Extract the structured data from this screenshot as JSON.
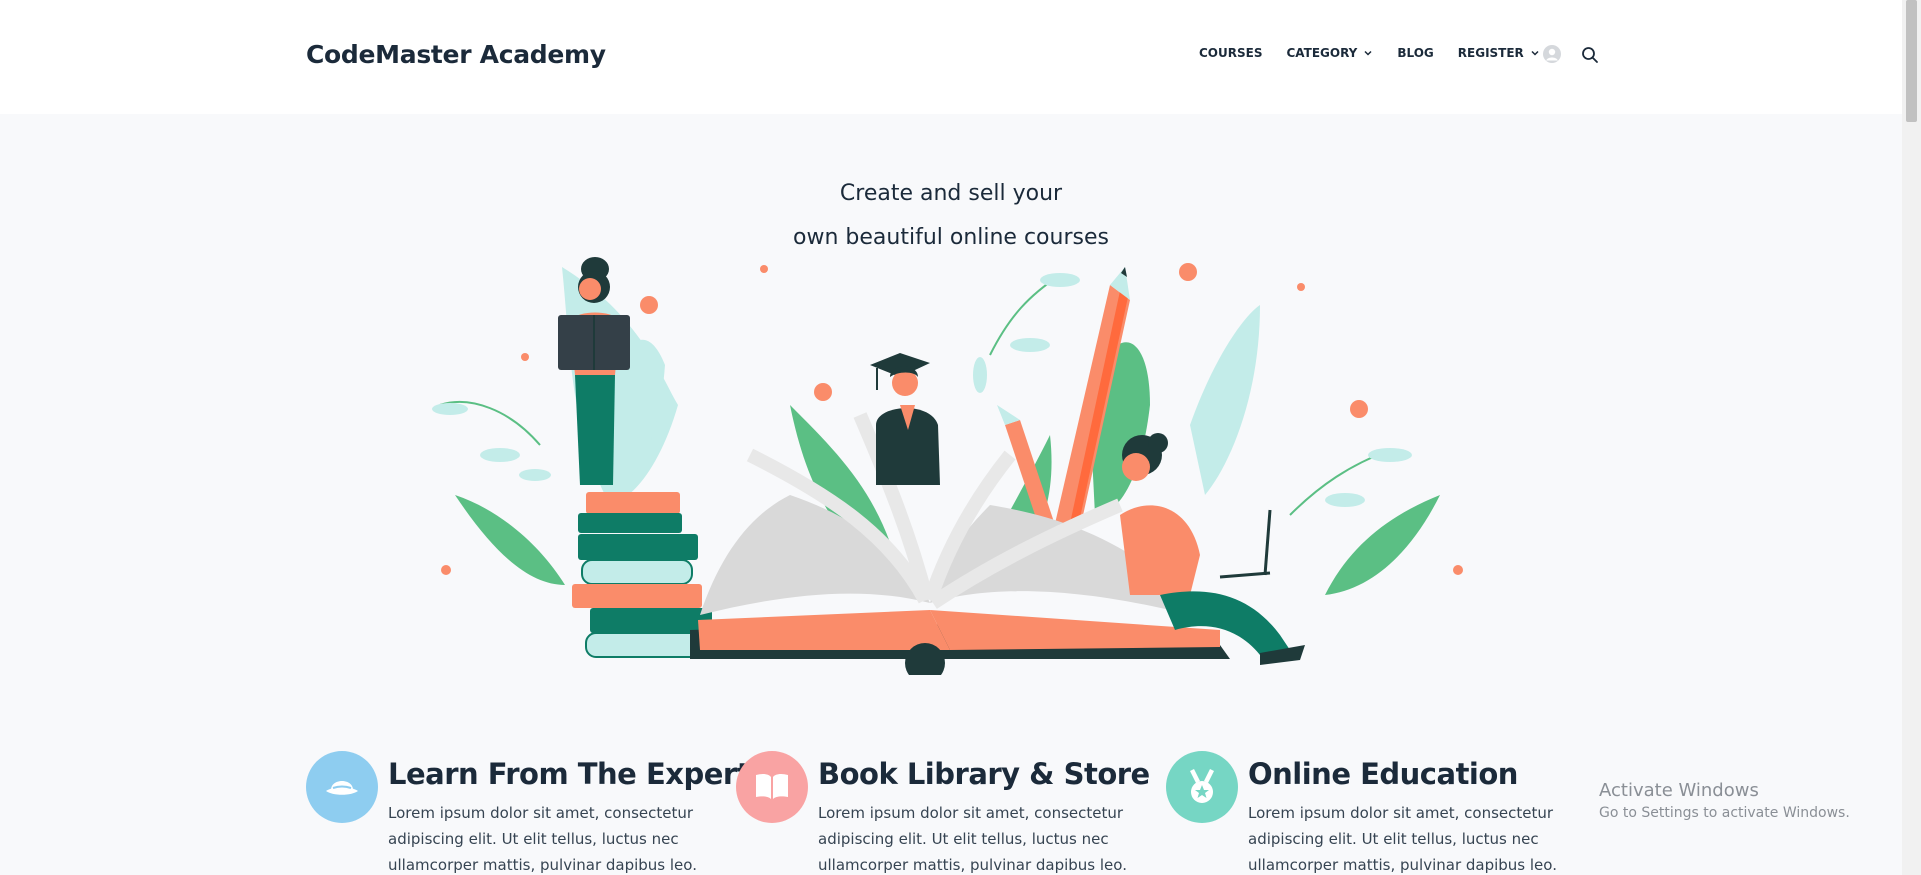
{
  "header": {
    "logo": "CodeMaster Academy",
    "nav": [
      {
        "label": "COURSES",
        "has_dropdown": false
      },
      {
        "label": "CATEGORY",
        "has_dropdown": true
      },
      {
        "label": "BLOG",
        "has_dropdown": false
      },
      {
        "label": "REGISTER",
        "has_dropdown": true
      }
    ],
    "icons": [
      "user-avatar-icon",
      "search-icon"
    ]
  },
  "hero": {
    "line1": "Create and sell your",
    "line2": "own beautiful online courses"
  },
  "features": [
    {
      "title": "Learn From The Experts",
      "description": "Lorem ipsum dolor sit amet, consectetur adipiscing elit. Ut elit tellus, luctus nec ullamcorper mattis, pulvinar dapibus leo.",
      "icon": "hat-icon",
      "color": "#8ecdf0"
    },
    {
      "title": "Book Library & Store",
      "description": "Lorem ipsum dolor sit amet, consectetur adipiscing elit. Ut elit tellus, luctus nec ullamcorper mattis, pulvinar dapibus leo.",
      "icon": "open-book-icon",
      "color": "#f9a3a3"
    },
    {
      "title": "Online Education",
      "description": "Lorem ipsum dolor sit amet, consectetur adipiscing elit. Ut elit tellus, luctus nec ullamcorper mattis, pulvinar dapibus leo.",
      "icon": "medal-icon",
      "color": "#76d6c4"
    }
  ],
  "os_overlay": {
    "title": "Activate Windows",
    "subtitle": "Go to Settings to activate Windows."
  },
  "colors": {
    "text_dark": "#1b2a3a",
    "page_bg": "#f8f9fb",
    "orange": "#fa8c6a",
    "teal_dark": "#0e7c66",
    "green": "#5bbf84",
    "mint": "#c3ece9"
  }
}
